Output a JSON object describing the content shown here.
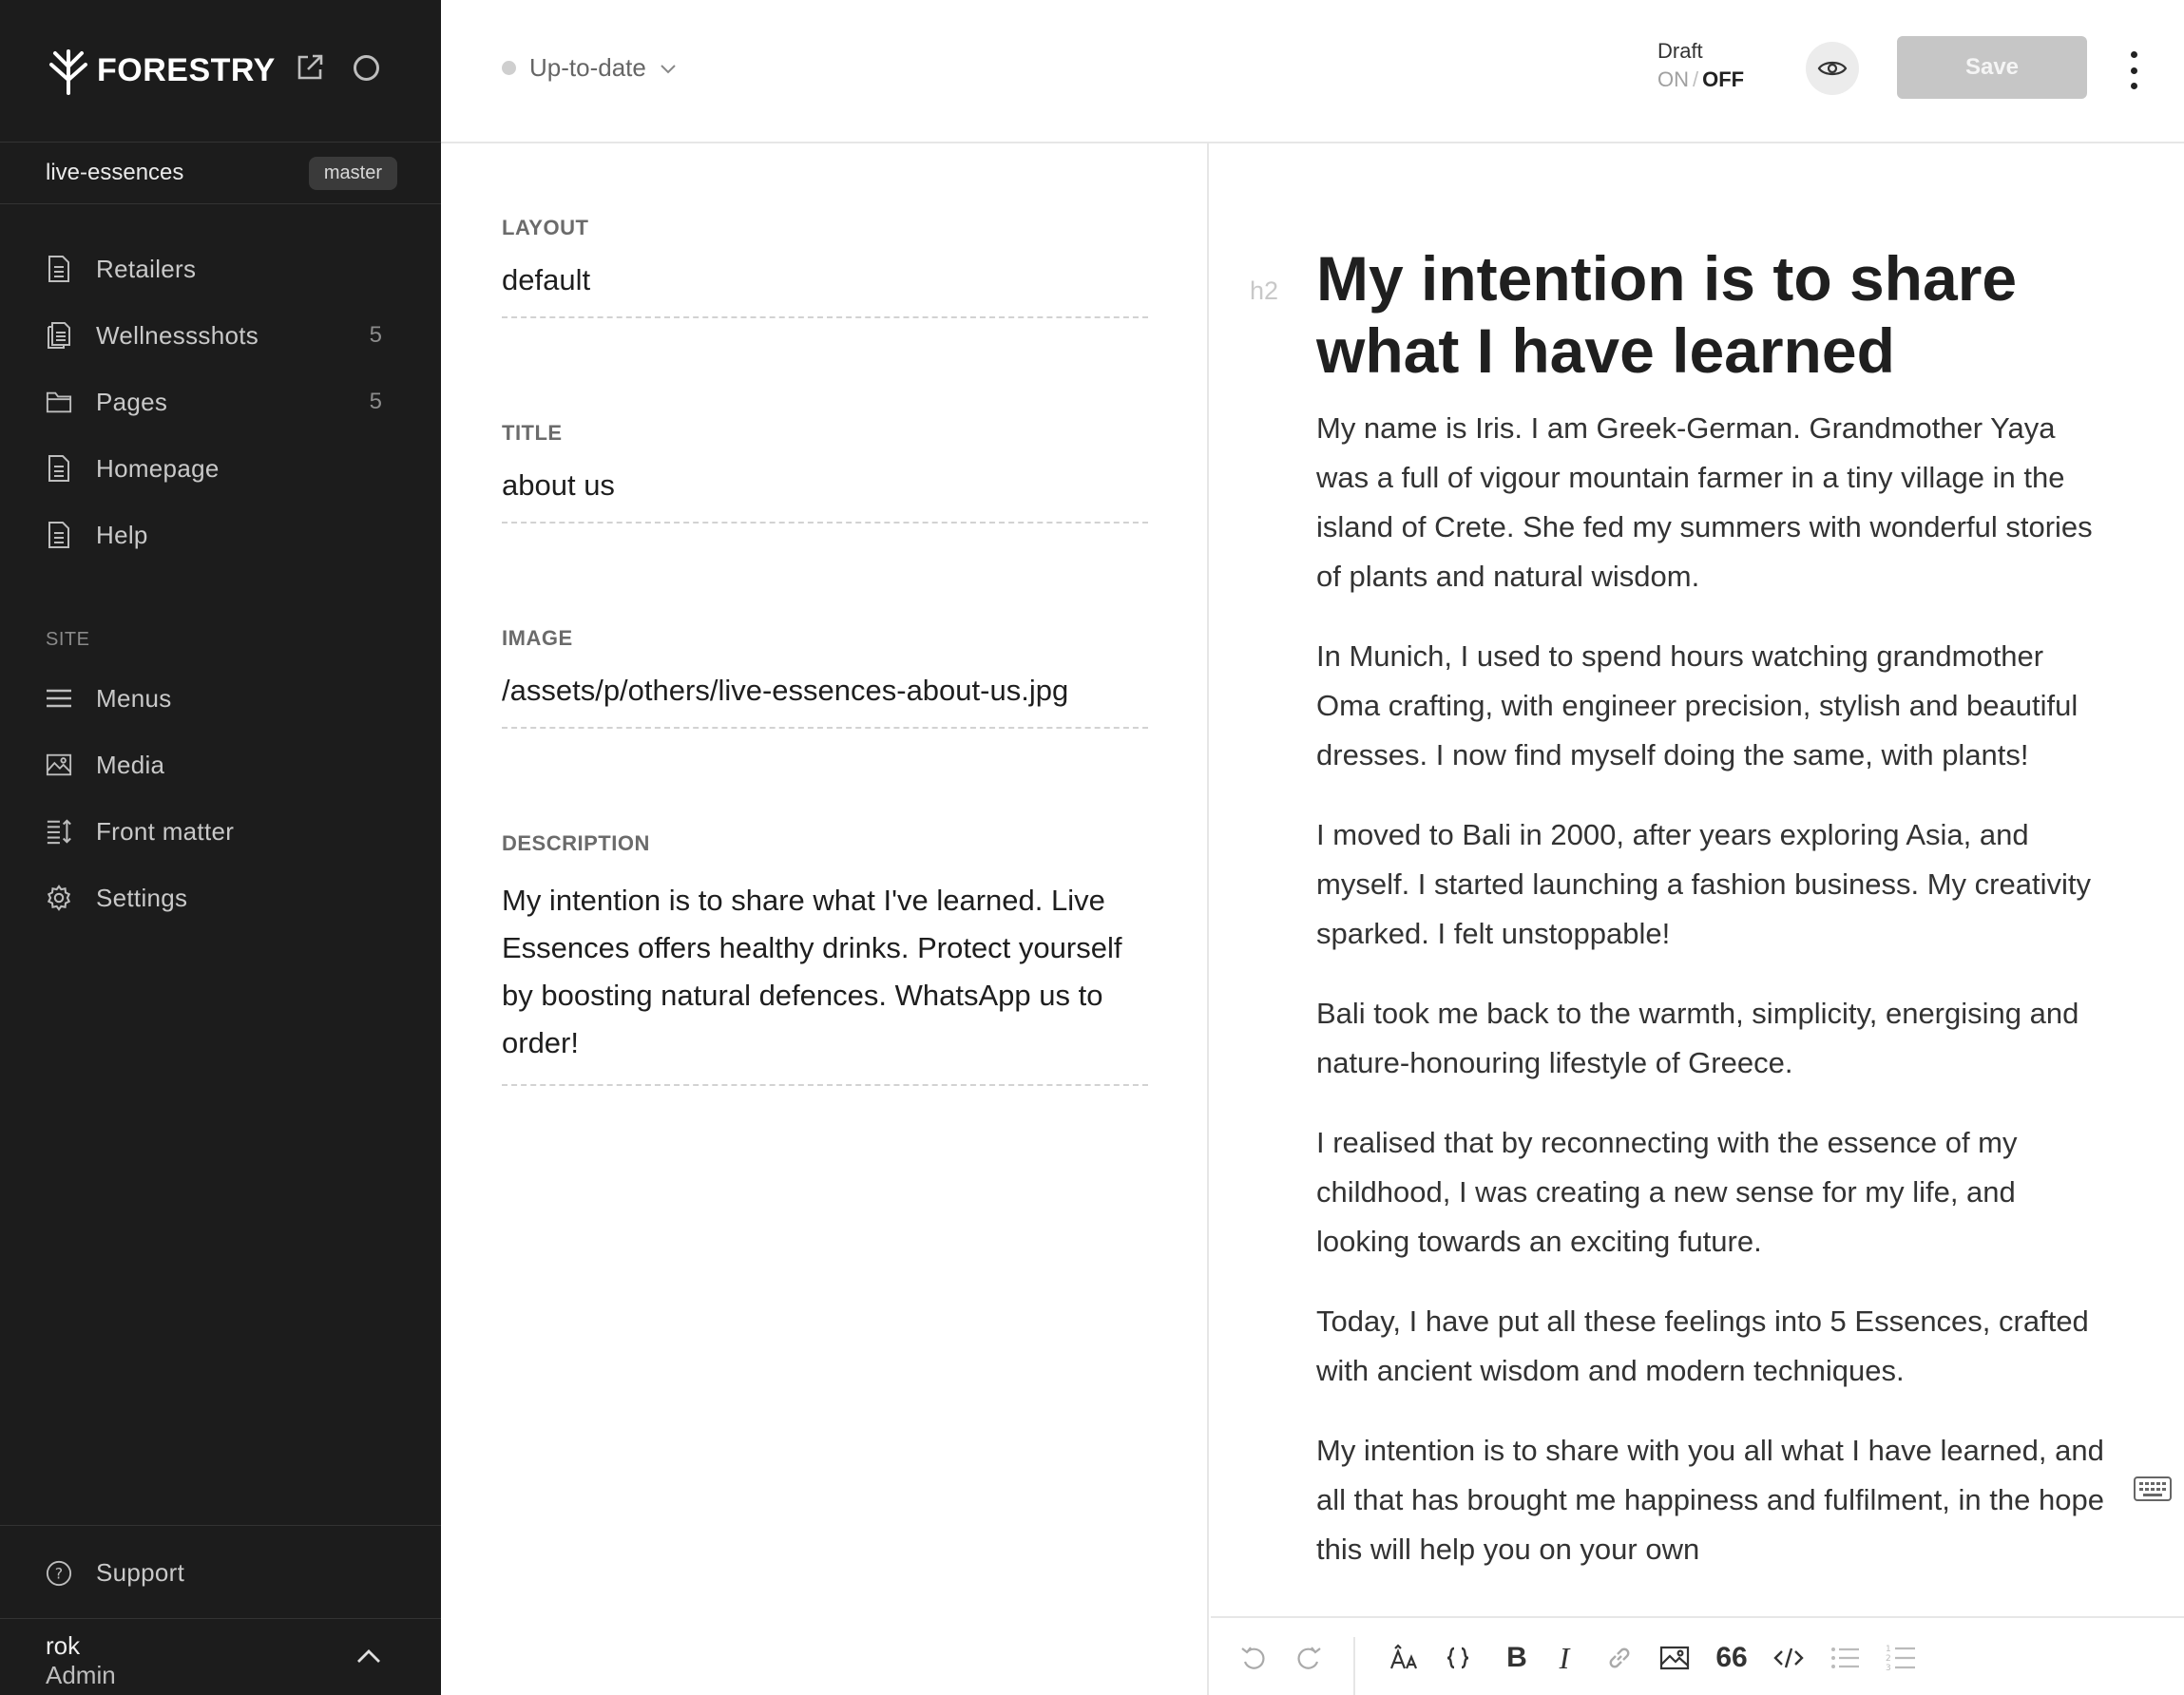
{
  "app": {
    "brand": "FORESTRY",
    "repo": "live-essences",
    "branch": "master"
  },
  "sidebar": {
    "items": [
      {
        "label": "Retailers",
        "count": "",
        "icon": "document-icon"
      },
      {
        "label": "Wellnessshots",
        "count": "5",
        "icon": "documents-icon"
      },
      {
        "label": "Pages",
        "count": "5",
        "icon": "folder-icon"
      },
      {
        "label": "Homepage",
        "count": "",
        "icon": "document-icon"
      },
      {
        "label": "Help",
        "count": "",
        "icon": "document-icon"
      }
    ],
    "site_section_label": "SITE",
    "site_items": [
      {
        "label": "Menus",
        "icon": "menu-icon"
      },
      {
        "label": "Media",
        "icon": "image-icon"
      },
      {
        "label": "Front matter",
        "icon": "front-matter-icon"
      },
      {
        "label": "Settings",
        "icon": "gear-icon"
      }
    ],
    "support_label": "Support",
    "user": {
      "name": "rok",
      "role": "Admin"
    }
  },
  "topbar": {
    "status": "Up-to-date",
    "draft_label": "Draft",
    "draft_on": "ON",
    "draft_sep": "/",
    "draft_off": "OFF",
    "save_label": "Save"
  },
  "front_matter": {
    "layout_label": "LAYOUT",
    "layout_value": "default",
    "title_label": "TITLE",
    "title_value": "about us",
    "image_label": "IMAGE",
    "image_value": "/assets/p/others/live-essences-about-us.jpg",
    "description_label": "DESCRIPTION",
    "description_value": "My intention is to share what I've learned. Live Essences offers healthy drinks. Protect yourself by boosting natural defences. WhatsApp us to order!"
  },
  "editor": {
    "heading_tag": "h2",
    "heading": "My intention is to share what I have learned",
    "paragraphs": [
      "My name is Iris. I am Greek-German. Grandmother Yaya was a  full of vigour mountain farmer in a tiny village in the island of Crete. She fed my summers with wonderful stories of plants and natural wisdom.",
      "In Munich, I used to spend hours watching grandmother Oma crafting, with engineer precision, stylish and beautiful dresses. I now find myself doing the same, with plants!",
      "I moved to Bali in 2000, after years exploring Asia, and myself. I started launching a fashion business. My creativity sparked. I felt unstoppable!",
      "Bali took me back to the warmth, simplicity, energising and nature-honouring lifestyle of Greece.",
      "I realised that by reconnecting with the essence of my childhood, I was creating a new sense for my life, and looking towards an exciting future.",
      "Today, I have put all these feelings into 5 Essences, crafted with ancient wisdom and modern techniques.",
      "My intention is to share with you all what I have learned, and all that has brought me happiness and fulfilment, in the hope this will help you on your own"
    ]
  },
  "toolbar": {
    "quote_glyph": "66",
    "bold_glyph": "B",
    "italic_glyph": "I"
  }
}
